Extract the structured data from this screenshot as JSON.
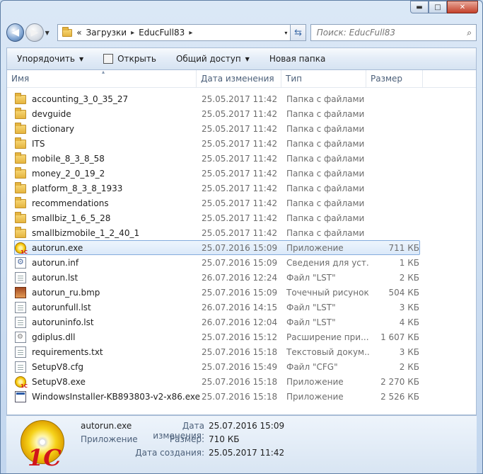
{
  "window": {
    "minimize": "▬",
    "maximize": "□",
    "close": "✕"
  },
  "address": {
    "chevron": "«",
    "segments": [
      "Загрузки",
      "EducFull83"
    ],
    "sep": "▸",
    "dropdown": "▾"
  },
  "search": {
    "placeholder": "Поиск: EducFull83",
    "icon": "⌕"
  },
  "toolbar": {
    "organize": "Упорядочить",
    "open": "Открыть",
    "share": "Общий доступ",
    "new_folder": "Новая папка",
    "arrow": "▼"
  },
  "columns": {
    "name": "Имя",
    "date": "Дата изменения",
    "type": "Тип",
    "size": "Размер",
    "sort": "▴"
  },
  "files": [
    {
      "name": "accounting_3_0_35_27",
      "date": "25.05.2017 11:42",
      "type": "Папка с файлами",
      "size": "",
      "icon": "folder"
    },
    {
      "name": "devguide",
      "date": "25.05.2017 11:42",
      "type": "Папка с файлами",
      "size": "",
      "icon": "folder"
    },
    {
      "name": "dictionary",
      "date": "25.05.2017 11:42",
      "type": "Папка с файлами",
      "size": "",
      "icon": "folder"
    },
    {
      "name": "ITS",
      "date": "25.05.2017 11:42",
      "type": "Папка с файлами",
      "size": "",
      "icon": "folder"
    },
    {
      "name": "mobile_8_3_8_58",
      "date": "25.05.2017 11:42",
      "type": "Папка с файлами",
      "size": "",
      "icon": "folder"
    },
    {
      "name": "money_2_0_19_2",
      "date": "25.05.2017 11:42",
      "type": "Папка с файлами",
      "size": "",
      "icon": "folder"
    },
    {
      "name": "platform_8_3_8_1933",
      "date": "25.05.2017 11:42",
      "type": "Папка с файлами",
      "size": "",
      "icon": "folder"
    },
    {
      "name": "recommendations",
      "date": "25.05.2017 11:42",
      "type": "Папка с файлами",
      "size": "",
      "icon": "folder"
    },
    {
      "name": "smallbiz_1_6_5_28",
      "date": "25.05.2017 11:42",
      "type": "Папка с файлами",
      "size": "",
      "icon": "folder"
    },
    {
      "name": "smallbizmobile_1_2_40_1",
      "date": "25.05.2017 11:42",
      "type": "Папка с файлами",
      "size": "",
      "icon": "folder"
    },
    {
      "name": "autorun.exe",
      "date": "25.07.2016 15:09",
      "type": "Приложение",
      "size": "711 КБ",
      "icon": "1c",
      "selected": true
    },
    {
      "name": "autorun.inf",
      "date": "25.07.2016 15:09",
      "type": "Сведения для уст...",
      "size": "1 КБ",
      "icon": "gear"
    },
    {
      "name": "autorun.lst",
      "date": "26.07.2016 12:24",
      "type": "Файл \"LST\"",
      "size": "2 КБ",
      "icon": "doc"
    },
    {
      "name": "autorun_ru.bmp",
      "date": "25.07.2016 15:09",
      "type": "Точечный рисунок",
      "size": "504 КБ",
      "icon": "bmp"
    },
    {
      "name": "autorunfull.lst",
      "date": "26.07.2016 14:15",
      "type": "Файл \"LST\"",
      "size": "3 КБ",
      "icon": "doc"
    },
    {
      "name": "autoruninfo.lst",
      "date": "26.07.2016 12:04",
      "type": "Файл \"LST\"",
      "size": "4 КБ",
      "icon": "doc"
    },
    {
      "name": "gdiplus.dll",
      "date": "25.07.2016 15:12",
      "type": "Расширение при...",
      "size": "1 607 КБ",
      "icon": "dll"
    },
    {
      "name": "requirements.txt",
      "date": "25.07.2016 15:18",
      "type": "Текстовый докум...",
      "size": "3 КБ",
      "icon": "doc"
    },
    {
      "name": "SetupV8.cfg",
      "date": "25.07.2016 15:49",
      "type": "Файл \"CFG\"",
      "size": "2 КБ",
      "icon": "doc"
    },
    {
      "name": "SetupV8.exe",
      "date": "25.07.2016 15:18",
      "type": "Приложение",
      "size": "2 270 КБ",
      "icon": "1c"
    },
    {
      "name": "WindowsInstaller-KB893803-v2-x86.exe",
      "date": "25.07.2016 15:18",
      "type": "Приложение",
      "size": "2 526 КБ",
      "icon": "exe"
    }
  ],
  "details": {
    "name": "autorun.exe",
    "type": "Приложение",
    "modified_label": "Дата изменения:",
    "modified": "25.07.2016 15:09",
    "size_label": "Размер:",
    "size": "710 КБ",
    "created_label": "Дата создания:",
    "created": "25.05.2017 11:42",
    "logo_text": "1С"
  }
}
